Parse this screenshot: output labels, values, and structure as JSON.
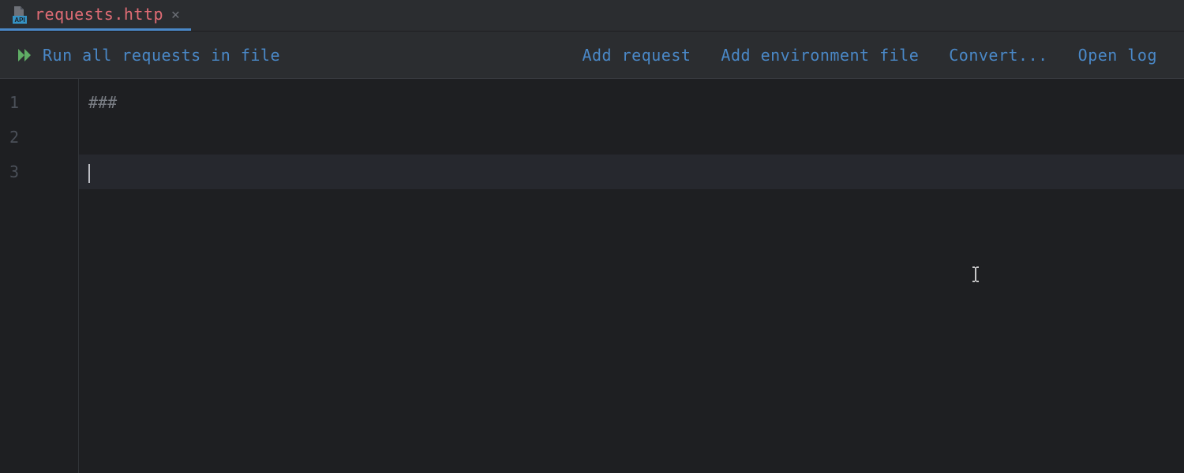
{
  "tab": {
    "icon_badge": "API",
    "filename": "requests.http"
  },
  "toolbar": {
    "run_label": "Run all requests in file",
    "links": {
      "add_request": "Add request",
      "add_env_file": "Add environment file",
      "convert": "Convert...",
      "open_log": "Open log"
    }
  },
  "editor": {
    "lines": [
      {
        "num": "1",
        "text": "###",
        "active": false
      },
      {
        "num": "2",
        "text": "",
        "active": false
      },
      {
        "num": "3",
        "text": "",
        "active": true
      }
    ]
  }
}
